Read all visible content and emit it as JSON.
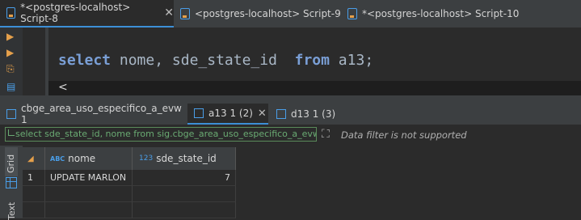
{
  "editor_tabs": [
    {
      "label": "*<postgres-localhost> Script-8",
      "active": true,
      "close": "✕"
    },
    {
      "label": "<postgres-localhost> Script-9",
      "active": false
    },
    {
      "label": "*<postgres-localhost> Script-10",
      "active": false
    }
  ],
  "editor": {
    "code": {
      "kw1": "select",
      "cols": " nome, sde_state_id  ",
      "kw2": "from",
      "rest": " a13;"
    },
    "scroll_left": "<"
  },
  "result_tabs": [
    {
      "label": "cbge_area_uso_especifico_a_evw 1",
      "active": false
    },
    {
      "label": "a13 1 (2)",
      "active": true,
      "close": "✕"
    },
    {
      "label": "d13 1 (3)",
      "active": false
    }
  ],
  "filter": {
    "query": "select sde_state_id, nome from sig.cbge_area_uso_especifico_a_evw v",
    "message": "Data filter is not supported"
  },
  "side_tabs": {
    "grid": "Grid",
    "text": "Text"
  },
  "table": {
    "columns": [
      {
        "type": "ABC",
        "name": "nome"
      },
      {
        "type": "123",
        "name": "sde_state_id"
      }
    ],
    "rows": [
      {
        "num": "1",
        "nome": "UPDATE MARLON",
        "sde_state_id": "7"
      }
    ]
  }
}
